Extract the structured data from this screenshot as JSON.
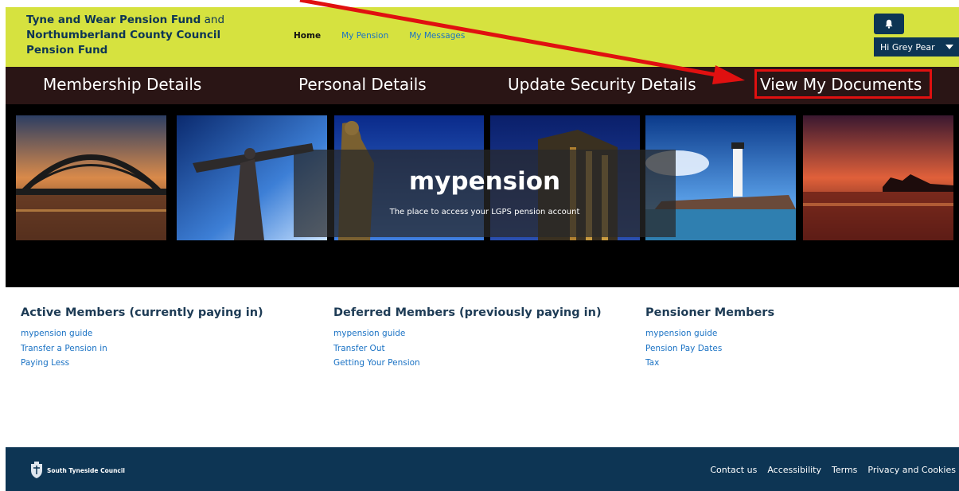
{
  "header": {
    "brand_line1_bold": "Tyne and Wear Pension Fund",
    "brand_line1_plain": " and",
    "brand_line2": "Northumberland County Council",
    "brand_line3": "Pension Fund",
    "nav": [
      {
        "label": "Home"
      },
      {
        "label": "My Pension"
      },
      {
        "label": "My Messages"
      }
    ],
    "notifications_icon": "bell-icon",
    "user_greeting": "Hi Grey Pear",
    "background_color": "#d6e23f"
  },
  "main_nav": {
    "items": [
      {
        "label": "Membership Details"
      },
      {
        "label": "Personal Details"
      },
      {
        "label": "Update Security Details"
      },
      {
        "label": "View My Documents"
      }
    ],
    "highlighted_item": "View My Documents",
    "highlight_color": "#e01010"
  },
  "banner": {
    "title": "mypension",
    "subtitle": "The place to access your LGPS pension account"
  },
  "columns": [
    {
      "heading": "Active Members (currently paying in)",
      "links": [
        "mypension guide",
        "Transfer a Pension in",
        "Paying Less"
      ]
    },
    {
      "heading": "Deferred Members (previously paying in)",
      "links": [
        "mypension guide",
        "Transfer Out",
        "Getting Your Pension"
      ]
    },
    {
      "heading": "Pensioner Members",
      "links": [
        "mypension guide",
        "Pension Pay Dates",
        "Tax"
      ]
    }
  ],
  "footer": {
    "council_name": "South Tyneside Council",
    "links": [
      "Contact us",
      "Accessibility",
      "Terms",
      "Privacy and Cookies"
    ],
    "background_color": "#0d3554"
  }
}
